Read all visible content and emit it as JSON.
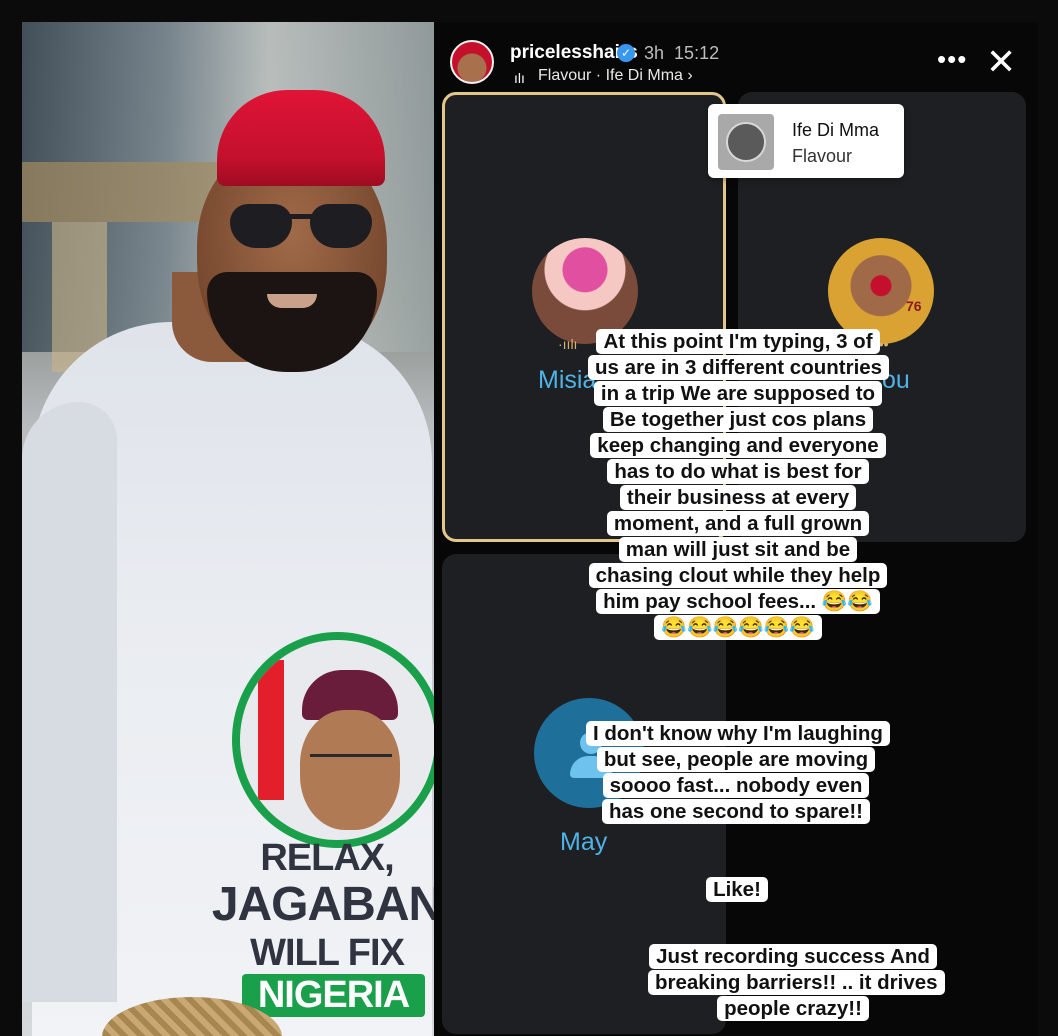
{
  "left_photo": {
    "shirt_text": {
      "line1": "RELAX,",
      "line2": "JAGABAN",
      "line3": "WILL FIX",
      "line4": "NIGERIA"
    }
  },
  "story": {
    "header": {
      "username": "pricelesshairs",
      "time_ago": "3h",
      "clock": "15:12",
      "music": "Flavour · Ife Di Mma ›"
    },
    "song_sticker": {
      "title": "Ife Di Mma",
      "artist": "Flavour"
    },
    "contacts": [
      {
        "name": "Misia"
      },
      {
        "name": "ou"
      },
      {
        "name": "May"
      }
    ],
    "captions": {
      "main": "At this point I'm typing, 3 of us are in 3 different countries in a trip We are supposed to Be together just cos plans keep changing and everyone has to do what is best for their business at every moment, and a full grown man will just sit and be chasing clout while they help him pay school fees... 😂😂😂😂😂😂😂😂",
      "second": "I don't know why I'm laughing but see, people are moving soooo fast... nobody even has one second to spare!!",
      "third": "Like!",
      "fourth": "Just recording success And breaking barriers!! .. it drives people crazy!!"
    }
  },
  "colors": {
    "cap_red": "#c4102c",
    "robe_white": "#e9ecf1",
    "apc_green": "#1aa04a",
    "contact_name_blue": "#4fb3e8",
    "selected_border_gold": "#e2c788"
  },
  "icons": {
    "verified": "verified-badge-icon",
    "music": "music-bars-icon",
    "more": "more-options-icon",
    "close": "close-icon"
  }
}
